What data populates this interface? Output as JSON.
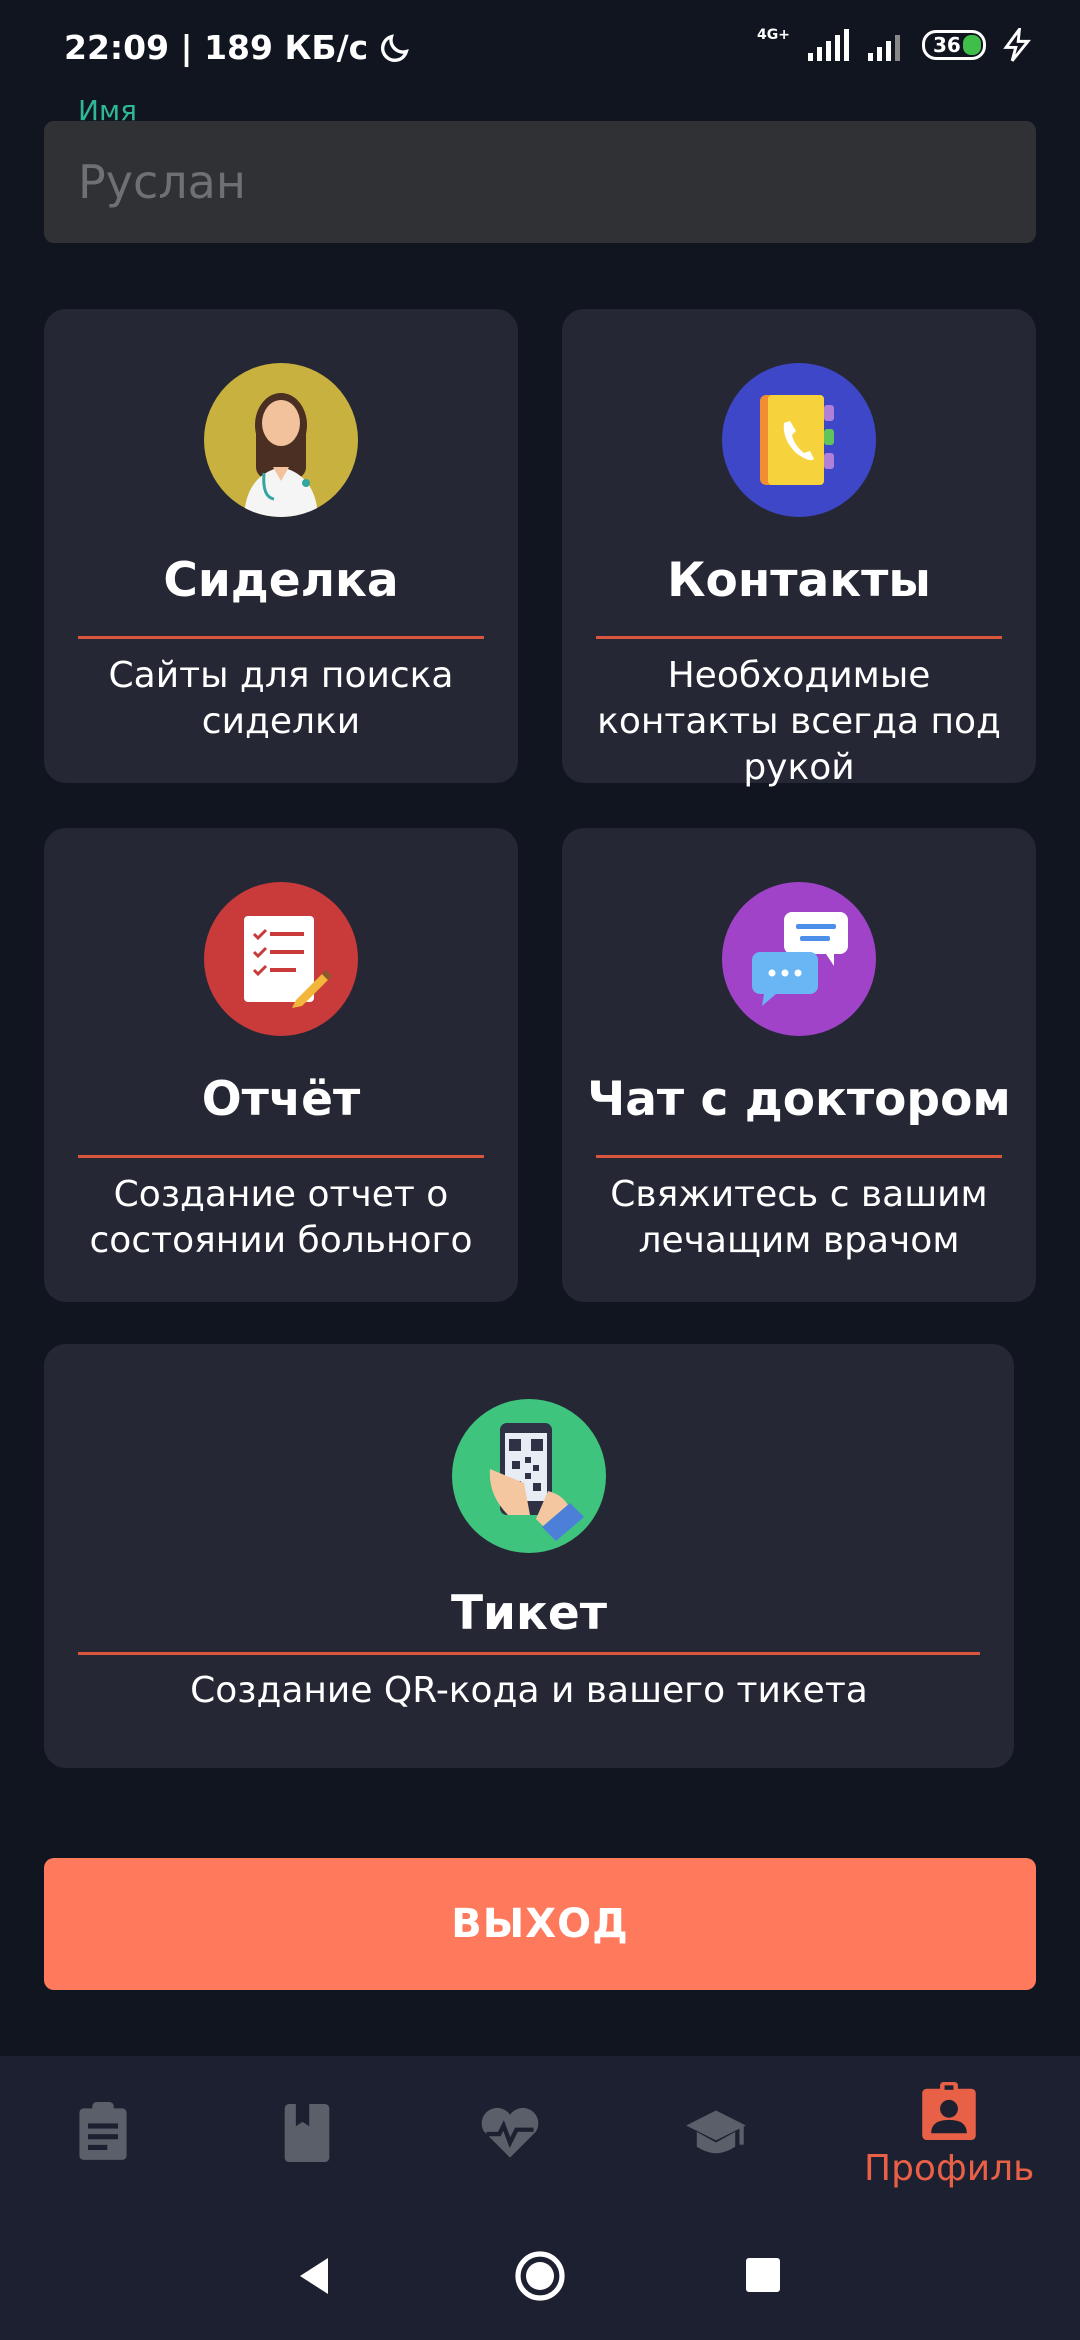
{
  "status_bar": {
    "time_speed": "22:09 | 189 КБ/с",
    "network": "4G+",
    "battery": "36"
  },
  "profile": {
    "name_label": "Имя",
    "name_value": "Руслан"
  },
  "cards": [
    {
      "title": "Сиделка",
      "description": "Сайты для поиска сиделки",
      "icon": "nurse-icon",
      "color": "#c9b13f"
    },
    {
      "title": "Контакты",
      "description": "Необходимые контакты всегда под рукой",
      "icon": "contacts-book-icon",
      "color": "#3f47c9"
    },
    {
      "title": "Отчёт",
      "description": "Создание отчет о состоянии больного",
      "icon": "report-checklist-icon",
      "color": "#c93b3b"
    },
    {
      "title": "Чат с доктором",
      "description": "Свяжитесь с вашим лечащим врачом",
      "icon": "chat-bubbles-icon",
      "color": "#a043c9"
    },
    {
      "title": "Тикет",
      "description": "Создание QR-кода и вашего тикета",
      "icon": "qr-phone-icon",
      "color": "#3fc47e"
    }
  ],
  "exit_button": "ВЫХОД",
  "bottom_nav": {
    "items": [
      {
        "icon": "clipboard-icon"
      },
      {
        "icon": "book-icon"
      },
      {
        "icon": "heart-pulse-icon"
      },
      {
        "icon": "graduation-cap-icon"
      },
      {
        "icon": "profile-badge-icon",
        "label": "Профиль",
        "active": true
      }
    ]
  },
  "colors": {
    "accent": "#ff7a5c",
    "active_nav": "#e86046",
    "label": "#2fb796",
    "background": "#111520",
    "card": "#252834"
  }
}
